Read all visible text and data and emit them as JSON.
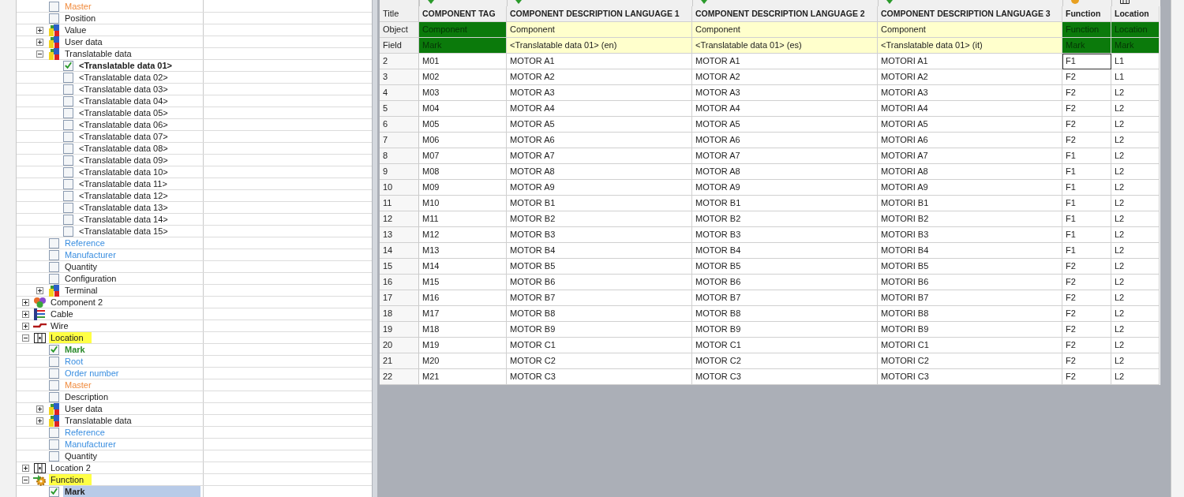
{
  "tree": {
    "items": [
      {
        "children": [
          {
            "label": "Master",
            "kind": "field",
            "color": "#f08a3c",
            "checked": false,
            "selected": false
          },
          {
            "label": "Position",
            "kind": "field",
            "color": "#202020",
            "checked": false,
            "selected": false
          },
          {
            "label": "Value",
            "kind": "data-group",
            "expanded": false,
            "selected": false
          },
          {
            "label": "User data",
            "kind": "data-group",
            "expanded": false,
            "selected": false
          },
          {
            "label": "Translatable data",
            "kind": "data-group",
            "expanded": true,
            "selected": false,
            "children": [
              {
                "label": "<Translatable data 01>",
                "kind": "field",
                "color": "#202020",
                "checked": true,
                "selected": false
              },
              {
                "label": "<Translatable data 02>",
                "kind": "field",
                "color": "#202020",
                "checked": false,
                "selected": false
              },
              {
                "label": "<Translatable data 03>",
                "kind": "field",
                "color": "#202020",
                "checked": false,
                "selected": false
              },
              {
                "label": "<Translatable data 04>",
                "kind": "field",
                "color": "#202020",
                "checked": false,
                "selected": false
              },
              {
                "label": "<Translatable data 05>",
                "kind": "field",
                "color": "#202020",
                "checked": false,
                "selected": false
              },
              {
                "label": "<Translatable data 06>",
                "kind": "field",
                "color": "#202020",
                "checked": false,
                "selected": false
              },
              {
                "label": "<Translatable data 07>",
                "kind": "field",
                "color": "#202020",
                "checked": false,
                "selected": false
              },
              {
                "label": "<Translatable data 08>",
                "kind": "field",
                "color": "#202020",
                "checked": false,
                "selected": false
              },
              {
                "label": "<Translatable data 09>",
                "kind": "field",
                "color": "#202020",
                "checked": false,
                "selected": false
              },
              {
                "label": "<Translatable data 10>",
                "kind": "field",
                "color": "#202020",
                "checked": false,
                "selected": false
              },
              {
                "label": "<Translatable data 11>",
                "kind": "field",
                "color": "#202020",
                "checked": false,
                "selected": false
              },
              {
                "label": "<Translatable data 12>",
                "kind": "field",
                "color": "#202020",
                "checked": false,
                "selected": false
              },
              {
                "label": "<Translatable data 13>",
                "kind": "field",
                "color": "#202020",
                "checked": false,
                "selected": false
              },
              {
                "label": "<Translatable data 14>",
                "kind": "field",
                "color": "#202020",
                "checked": false,
                "selected": false
              },
              {
                "label": "<Translatable data 15>",
                "kind": "field",
                "color": "#202020",
                "checked": false,
                "selected": false
              }
            ]
          },
          {
            "label": "Reference",
            "kind": "field",
            "color": "#3a8ee0",
            "checked": false,
            "selected": false
          },
          {
            "label": "Manufacturer",
            "kind": "field",
            "color": "#3a8ee0",
            "checked": false,
            "selected": false
          },
          {
            "label": "Quantity",
            "kind": "field",
            "color": "#202020",
            "checked": false,
            "selected": false
          },
          {
            "label": "Configuration",
            "kind": "field",
            "color": "#202020",
            "checked": false,
            "selected": false
          },
          {
            "label": "Terminal",
            "kind": "data-group",
            "expanded": false,
            "selected": false
          }
        ]
      },
      {
        "label": "Component 2",
        "kind": "component",
        "expanded": false,
        "highlighted": false,
        "selected": false
      },
      {
        "label": "Cable",
        "kind": "cable",
        "expanded": false,
        "highlighted": false,
        "selected": false
      },
      {
        "label": "Wire",
        "kind": "wire",
        "expanded": false,
        "highlighted": false,
        "selected": false
      },
      {
        "label": "Location",
        "kind": "location",
        "expanded": true,
        "highlighted": true,
        "selected": false,
        "children": [
          {
            "label": "Mark",
            "kind": "field",
            "color": "#2a8a2a",
            "checked": true,
            "selected": false
          },
          {
            "label": "Root",
            "kind": "field",
            "color": "#3a8ee0",
            "checked": false,
            "selected": false
          },
          {
            "label": "Order number",
            "kind": "field",
            "color": "#3a8ee0",
            "checked": false,
            "selected": false
          },
          {
            "label": "Master",
            "kind": "field",
            "color": "#f08a3c",
            "checked": false,
            "selected": false
          },
          {
            "label": "Description",
            "kind": "field",
            "color": "#202020",
            "checked": false,
            "selected": false
          },
          {
            "label": "User data",
            "kind": "data-group",
            "expanded": false,
            "selected": false
          },
          {
            "label": "Translatable data",
            "kind": "data-group",
            "expanded": false,
            "selected": false
          },
          {
            "label": "Reference",
            "kind": "field",
            "color": "#3a8ee0",
            "checked": false,
            "selected": false
          },
          {
            "label": "Manufacturer",
            "kind": "field",
            "color": "#3a8ee0",
            "checked": false,
            "selected": false
          },
          {
            "label": "Quantity",
            "kind": "field",
            "color": "#202020",
            "checked": false,
            "selected": false
          }
        ]
      },
      {
        "label": "Location 2",
        "kind": "location",
        "expanded": false,
        "highlighted": false,
        "selected": false
      },
      {
        "label": "Function",
        "kind": "function",
        "expanded": true,
        "highlighted": true,
        "selected": false,
        "children": [
          {
            "label": "Mark",
            "kind": "field",
            "color": "#202020",
            "checked": true,
            "selected": true
          }
        ]
      }
    ]
  },
  "table": {
    "header_labels": [
      "Title",
      "Object",
      "Field"
    ],
    "columns": [
      {
        "title": "COMPONENT TAG",
        "object": "Component",
        "field": "Mark",
        "kind": "component-mark"
      },
      {
        "title": "COMPONENT DESCRIPTION LANGUAGE 1",
        "object": "Component",
        "field": "<Translatable data 01> (en)",
        "kind": "translatable"
      },
      {
        "title": "COMPONENT DESCRIPTION LANGUAGE 2",
        "object": "Component",
        "field": "<Translatable data 01> (es)",
        "kind": "translatable"
      },
      {
        "title": "COMPONENT DESCRIPTION LANGUAGE 3",
        "object": "Component",
        "field": "<Translatable data 01> (it)",
        "kind": "translatable"
      },
      {
        "title": "Function",
        "object": "Function",
        "field": "Mark",
        "kind": "function-mark"
      },
      {
        "title": "Location",
        "object": "Location",
        "field": "Mark",
        "kind": "location-mark"
      }
    ],
    "rows": [
      {
        "number": "2",
        "cells": [
          {
            "text": "M01",
            "focused": false
          },
          {
            "text": "MOTOR A1",
            "focused": false
          },
          {
            "text": "MOTOR A1",
            "focused": false
          },
          {
            "text": "MOTORI A1",
            "focused": false
          },
          {
            "text": "F1",
            "focused": true
          },
          {
            "text": "L1",
            "focused": false
          }
        ]
      },
      {
        "number": "3",
        "cells": [
          {
            "text": "M02",
            "focused": false
          },
          {
            "text": "MOTOR A2",
            "focused": false
          },
          {
            "text": "MOTOR A2",
            "focused": false
          },
          {
            "text": "MOTORI A2",
            "focused": false
          },
          {
            "text": "F2",
            "focused": false
          },
          {
            "text": "L1",
            "focused": false
          }
        ]
      },
      {
        "number": "4",
        "cells": [
          {
            "text": "M03",
            "focused": false
          },
          {
            "text": "MOTOR A3",
            "focused": false
          },
          {
            "text": "MOTOR A3",
            "focused": false
          },
          {
            "text": "MOTORI A3",
            "focused": false
          },
          {
            "text": "F2",
            "focused": false
          },
          {
            "text": "L2",
            "focused": false
          }
        ]
      },
      {
        "number": "5",
        "cells": [
          {
            "text": "M04",
            "focused": false
          },
          {
            "text": "MOTOR A4",
            "focused": false
          },
          {
            "text": "MOTOR A4",
            "focused": false
          },
          {
            "text": "MOTORI A4",
            "focused": false
          },
          {
            "text": "F2",
            "focused": false
          },
          {
            "text": "L2",
            "focused": false
          }
        ]
      },
      {
        "number": "6",
        "cells": [
          {
            "text": "M05",
            "focused": false
          },
          {
            "text": "MOTOR A5",
            "focused": false
          },
          {
            "text": "MOTOR A5",
            "focused": false
          },
          {
            "text": "MOTORI A5",
            "focused": false
          },
          {
            "text": "F2",
            "focused": false
          },
          {
            "text": "L2",
            "focused": false
          }
        ]
      },
      {
        "number": "7",
        "cells": [
          {
            "text": "M06",
            "focused": false
          },
          {
            "text": "MOTOR A6",
            "focused": false
          },
          {
            "text": "MOTOR A6",
            "focused": false
          },
          {
            "text": "MOTORI A6",
            "focused": false
          },
          {
            "text": "F2",
            "focused": false
          },
          {
            "text": "L2",
            "focused": false
          }
        ]
      },
      {
        "number": "8",
        "cells": [
          {
            "text": "M07",
            "focused": false
          },
          {
            "text": "MOTOR A7",
            "focused": false
          },
          {
            "text": "MOTOR A7",
            "focused": false
          },
          {
            "text": "MOTORI A7",
            "focused": false
          },
          {
            "text": "F1",
            "focused": false
          },
          {
            "text": "L2",
            "focused": false
          }
        ]
      },
      {
        "number": "9",
        "cells": [
          {
            "text": "M08",
            "focused": false
          },
          {
            "text": "MOTOR A8",
            "focused": false
          },
          {
            "text": "MOTOR A8",
            "focused": false
          },
          {
            "text": "MOTORI A8",
            "focused": false
          },
          {
            "text": "F1",
            "focused": false
          },
          {
            "text": "L2",
            "focused": false
          }
        ]
      },
      {
        "number": "10",
        "cells": [
          {
            "text": "M09",
            "focused": false
          },
          {
            "text": "MOTOR A9",
            "focused": false
          },
          {
            "text": "MOTOR A9",
            "focused": false
          },
          {
            "text": "MOTORI A9",
            "focused": false
          },
          {
            "text": "F1",
            "focused": false
          },
          {
            "text": "L2",
            "focused": false
          }
        ]
      },
      {
        "number": "11",
        "cells": [
          {
            "text": "M10",
            "focused": false
          },
          {
            "text": "MOTOR B1",
            "focused": false
          },
          {
            "text": "MOTOR B1",
            "focused": false
          },
          {
            "text": "MOTORI B1",
            "focused": false
          },
          {
            "text": "F1",
            "focused": false
          },
          {
            "text": "L2",
            "focused": false
          }
        ]
      },
      {
        "number": "12",
        "cells": [
          {
            "text": "M11",
            "focused": false
          },
          {
            "text": "MOTOR B2",
            "focused": false
          },
          {
            "text": "MOTOR B2",
            "focused": false
          },
          {
            "text": "MOTORI B2",
            "focused": false
          },
          {
            "text": "F1",
            "focused": false
          },
          {
            "text": "L2",
            "focused": false
          }
        ]
      },
      {
        "number": "13",
        "cells": [
          {
            "text": "M12",
            "focused": false
          },
          {
            "text": "MOTOR B3",
            "focused": false
          },
          {
            "text": "MOTOR B3",
            "focused": false
          },
          {
            "text": "MOTORI B3",
            "focused": false
          },
          {
            "text": "F1",
            "focused": false
          },
          {
            "text": "L2",
            "focused": false
          }
        ]
      },
      {
        "number": "14",
        "cells": [
          {
            "text": "M13",
            "focused": false
          },
          {
            "text": "MOTOR B4",
            "focused": false
          },
          {
            "text": "MOTOR B4",
            "focused": false
          },
          {
            "text": "MOTORI B4",
            "focused": false
          },
          {
            "text": "F1",
            "focused": false
          },
          {
            "text": "L2",
            "focused": false
          }
        ]
      },
      {
        "number": "15",
        "cells": [
          {
            "text": "M14",
            "focused": false
          },
          {
            "text": "MOTOR B5",
            "focused": false
          },
          {
            "text": "MOTOR B5",
            "focused": false
          },
          {
            "text": "MOTORI B5",
            "focused": false
          },
          {
            "text": "F2",
            "focused": false
          },
          {
            "text": "L2",
            "focused": false
          }
        ]
      },
      {
        "number": "16",
        "cells": [
          {
            "text": "M15",
            "focused": false
          },
          {
            "text": "MOTOR B6",
            "focused": false
          },
          {
            "text": "MOTOR B6",
            "focused": false
          },
          {
            "text": "MOTORI B6",
            "focused": false
          },
          {
            "text": "F2",
            "focused": false
          },
          {
            "text": "L2",
            "focused": false
          }
        ]
      },
      {
        "number": "17",
        "cells": [
          {
            "text": "M16",
            "focused": false
          },
          {
            "text": "MOTOR B7",
            "focused": false
          },
          {
            "text": "MOTOR B7",
            "focused": false
          },
          {
            "text": "MOTORI B7",
            "focused": false
          },
          {
            "text": "F2",
            "focused": false
          },
          {
            "text": "L2",
            "focused": false
          }
        ]
      },
      {
        "number": "18",
        "cells": [
          {
            "text": "M17",
            "focused": false
          },
          {
            "text": "MOTOR B8",
            "focused": false
          },
          {
            "text": "MOTOR B8",
            "focused": false
          },
          {
            "text": "MOTORI B8",
            "focused": false
          },
          {
            "text": "F2",
            "focused": false
          },
          {
            "text": "L2",
            "focused": false
          }
        ]
      },
      {
        "number": "19",
        "cells": [
          {
            "text": "M18",
            "focused": false
          },
          {
            "text": "MOTOR B9",
            "focused": false
          },
          {
            "text": "MOTOR B9",
            "focused": false
          },
          {
            "text": "MOTORI B9",
            "focused": false
          },
          {
            "text": "F2",
            "focused": false
          },
          {
            "text": "L2",
            "focused": false
          }
        ]
      },
      {
        "number": "20",
        "cells": [
          {
            "text": "M19",
            "focused": false
          },
          {
            "text": "MOTOR C1",
            "focused": false
          },
          {
            "text": "MOTOR C1",
            "focused": false
          },
          {
            "text": "MOTORI C1",
            "focused": false
          },
          {
            "text": "F2",
            "focused": false
          },
          {
            "text": "L2",
            "focused": false
          }
        ]
      },
      {
        "number": "21",
        "cells": [
          {
            "text": "M20",
            "focused": false
          },
          {
            "text": "MOTOR C2",
            "focused": false
          },
          {
            "text": "MOTOR C2",
            "focused": false
          },
          {
            "text": "MOTORI C2",
            "focused": false
          },
          {
            "text": "F2",
            "focused": false
          },
          {
            "text": "L2",
            "focused": false
          }
        ]
      },
      {
        "number": "22",
        "cells": [
          {
            "text": "M21",
            "focused": false
          },
          {
            "text": "MOTOR C3",
            "focused": false
          },
          {
            "text": "MOTOR C3",
            "focused": false
          },
          {
            "text": "MOTORI C3",
            "focused": false
          },
          {
            "text": "F2",
            "focused": false
          },
          {
            "text": "L2",
            "focused": false
          }
        ]
      }
    ]
  }
}
